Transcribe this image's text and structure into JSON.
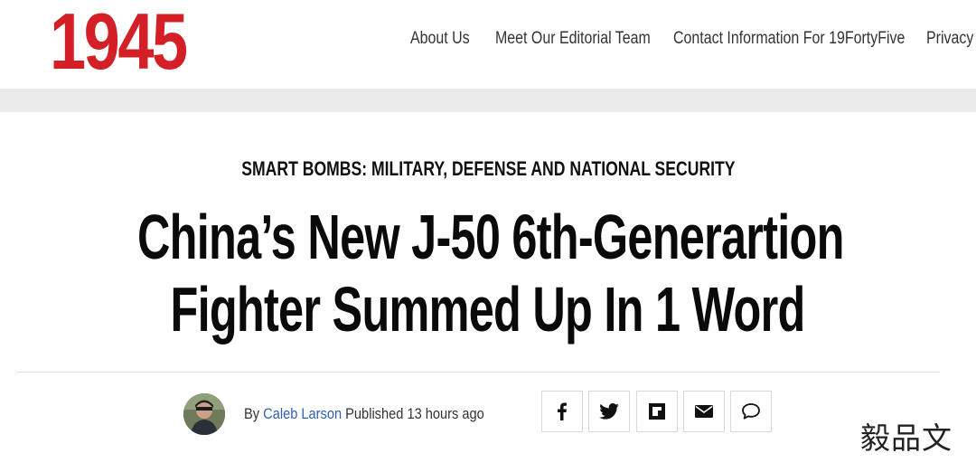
{
  "site": {
    "logo_text": "1945",
    "brand_color": "#d51f26"
  },
  "nav": {
    "items": [
      {
        "label": "About Us"
      },
      {
        "label": "Meet Our Editorial Team"
      },
      {
        "label": "Contact Information For 19FortyFive"
      },
      {
        "label": "Privacy"
      }
    ]
  },
  "article": {
    "category": "SMART BOMBS: MILITARY, DEFENSE AND NATIONAL SECURITY",
    "title_line1": "China’s New J-50 6th-Generartion",
    "title_line2": "Fighter Summed Up In 1 Word",
    "byline": {
      "by_label": "By",
      "author": "Caleb Larson",
      "published_label": "Published",
      "time_ago": "13 hours ago",
      "link_color": "#2f5fb3"
    }
  },
  "share_buttons": [
    {
      "icon": "facebook-icon"
    },
    {
      "icon": "twitter-icon"
    },
    {
      "icon": "flipboard-icon"
    },
    {
      "icon": "email-icon"
    },
    {
      "icon": "comment-icon"
    }
  ],
  "watermark": {
    "text": "毅品文"
  }
}
